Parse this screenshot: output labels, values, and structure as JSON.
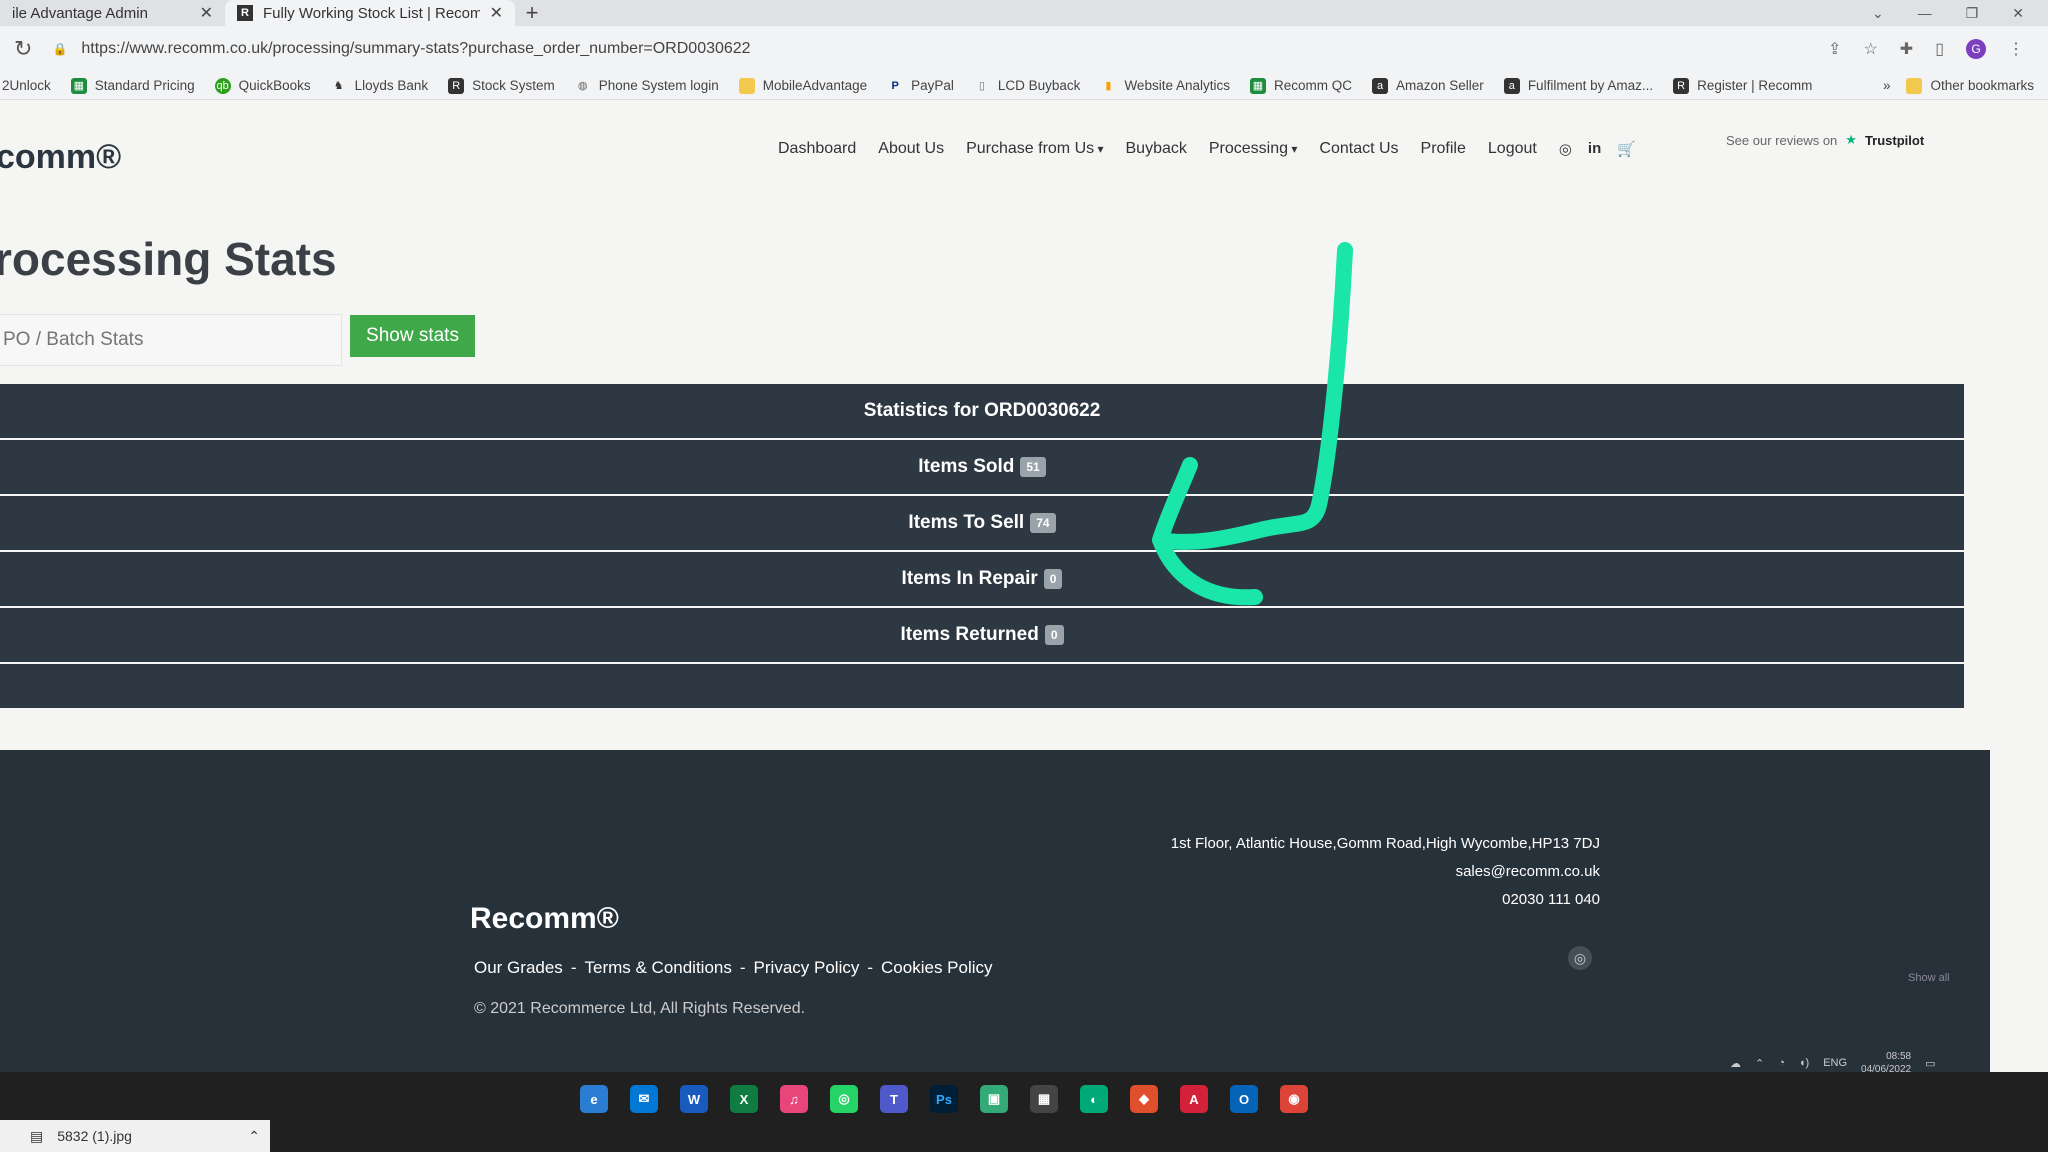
{
  "browser": {
    "tabs": [
      {
        "title": "ile Advantage Admin",
        "favicon": ""
      },
      {
        "title": "Fully Working Stock List | Recom",
        "favicon": "R"
      }
    ],
    "url": "https://www.recomm.co.uk/processing/summary-stats?purchase_order_number=ORD0030622",
    "profile_initial": "G",
    "bookmarks": [
      {
        "label": "2Unlock",
        "color": ""
      },
      {
        "label": "Standard Pricing",
        "color": "#1e8e3e"
      },
      {
        "label": "QuickBooks",
        "color": "#2ca01c"
      },
      {
        "label": "Lloyds Bank",
        "color": "#333333"
      },
      {
        "label": "Stock System",
        "color": "#333333"
      },
      {
        "label": "Phone System login",
        "color": "#666666"
      },
      {
        "label": "MobileAdvantage",
        "color": "#f2c94c"
      },
      {
        "label": "PayPal",
        "color": "#003087"
      },
      {
        "label": "LCD Buyback",
        "color": "#777777"
      },
      {
        "label": "Website Analytics",
        "color": "#f4a300"
      },
      {
        "label": "Recomm QC",
        "color": "#1e8e3e"
      },
      {
        "label": "Amazon Seller",
        "color": "#333333"
      },
      {
        "label": "Fulfilment by Amaz...",
        "color": "#333333"
      },
      {
        "label": "Register | Recomm",
        "color": "#333333"
      }
    ],
    "more_bookmarks": "»",
    "other_bookmarks": "Other bookmarks"
  },
  "site": {
    "logo": "comm®",
    "nav": [
      "Dashboard",
      "About Us",
      "Purchase from Us",
      "Buyback",
      "Processing",
      "Contact Us",
      "Profile",
      "Logout"
    ],
    "reviews_text": "See our reviews on",
    "trustpilot": "Trustpilot",
    "page_title": "rocessing Stats",
    "po_placeholder": "PO / Batch Stats",
    "show_stats_label": "Show stats"
  },
  "stats": {
    "header": "Statistics for ORD0030622",
    "rows": [
      {
        "label": "Items Sold",
        "count": "51"
      },
      {
        "label": "Items To Sell",
        "count": "74"
      },
      {
        "label": "Items In Repair",
        "count": "0"
      },
      {
        "label": "Items Returned",
        "count": "0"
      }
    ]
  },
  "footer": {
    "logo": "Recomm®",
    "links": [
      "Our Grades",
      "Terms & Conditions",
      "Privacy Policy",
      "Cookies Policy"
    ],
    "separator": "-",
    "copyright": "© 2021 Recommerce Ltd, All Rights Reserved.",
    "address": "1st Floor, Atlantic House,Gomm Road,High Wycombe,HP13 7DJ",
    "email": "sales@recomm.co.uk",
    "phone": "02030 111 040",
    "show_all": "Show all"
  },
  "taskbar": {
    "download_file": "5832 (1).jpg",
    "lang": "ENG",
    "time": "08:58",
    "date": "04/06/2022"
  },
  "colors": {
    "stats_bar": "#2d3842",
    "button_green": "#3fa94a",
    "annotation_arrow": "#19e6a8",
    "footer_bg": "#27313a"
  }
}
